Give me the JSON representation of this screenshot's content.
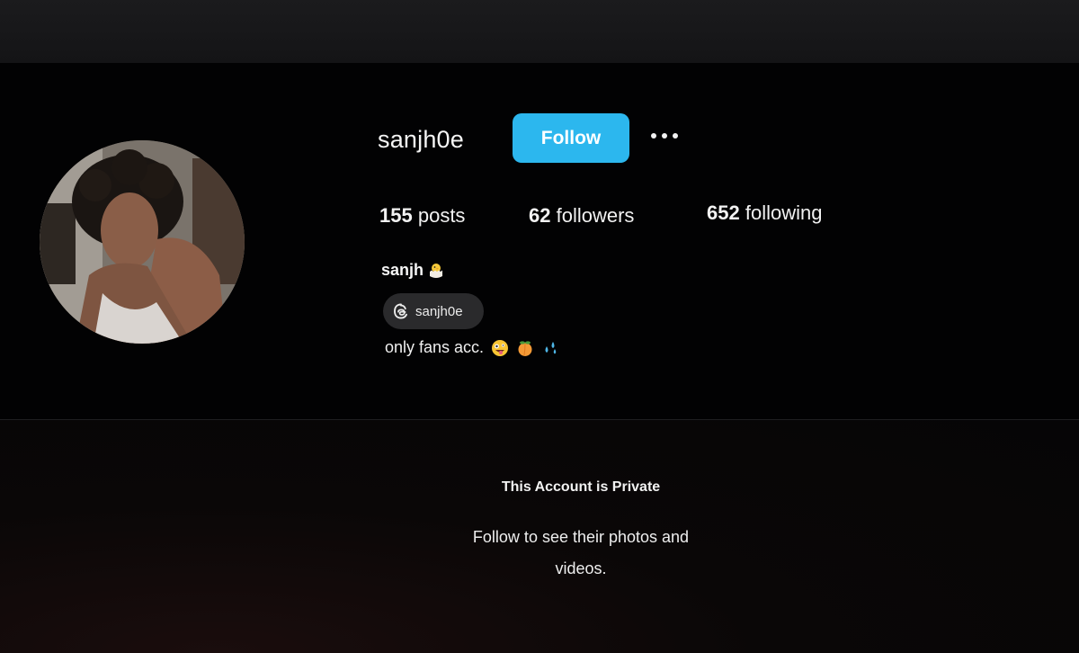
{
  "profile": {
    "username": "sanjh0e",
    "follow_label": "Follow",
    "more_options": "more-horizontal-icon",
    "stats": {
      "posts_count": "155",
      "posts_label": "posts",
      "followers_count": "62",
      "followers_label": "followers",
      "following_count": "652",
      "following_label": "following"
    },
    "display_name": "sanjh",
    "display_name_emoji": "hatching-chick-icon",
    "threads_handle": "sanjh0e",
    "bio_text": "only fans acc.",
    "bio_emojis": [
      "zany-face-icon",
      "peach-icon",
      "sweat-droplets-icon"
    ]
  },
  "private_notice": {
    "title": "This Account is Private",
    "description": "Follow to see their photos and videos."
  },
  "colors": {
    "background": "#020203",
    "follow_button": "#2cb7ee",
    "chip_background": "#2a2a2c",
    "text": "#f2f2f2"
  }
}
